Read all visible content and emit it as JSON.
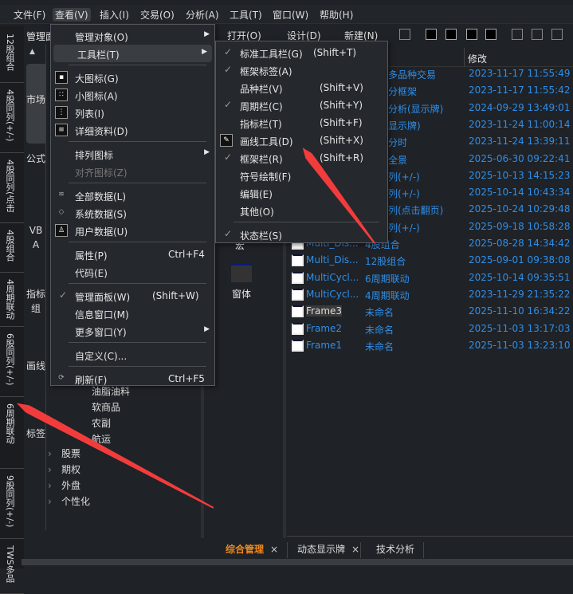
{
  "menubar": [
    "文件(F)",
    "查看(V)",
    "插入(I)",
    "交易(O)",
    "分析(A)",
    "工具(T)",
    "窗口(W)",
    "帮助(H)"
  ],
  "vertical_tabs": [
    "12股组合",
    "4股同列(+/-)",
    "4股同列(点击",
    "4股组合",
    "4周期联动",
    "6股同列(+/-)",
    "6周期联动",
    "9股同列(+/-)",
    "TWS多品"
  ],
  "panel_title": "管理面",
  "side_tabs": [
    "市场",
    "公式",
    "VBA",
    "指标组",
    "画线",
    "标签"
  ],
  "tree": {
    "items": [
      "油脂油料",
      "软商品",
      "农副",
      "航运"
    ],
    "groups": [
      "股票",
      "期权",
      "外盘",
      "个性化"
    ]
  },
  "toolbar": {
    "open": "打开(O)",
    "design": "设计(D)",
    "new": "新建(N)"
  },
  "icons_panel": {
    "macro": "宏",
    "form": "窗体"
  },
  "table": {
    "header_modified": "修改",
    "rows": [
      {
        "name": "",
        "desc": "多品种交易",
        "time": "2023-11-17 11:55:49"
      },
      {
        "name": "",
        "desc": "分框架",
        "time": "2023-11-17 11:55:42"
      },
      {
        "name": "",
        "desc": "分析(显示牌)",
        "time": "2024-09-29 13:49:01"
      },
      {
        "name": "",
        "desc": "显示牌)",
        "time": "2023-11-24 11:00:14"
      },
      {
        "name": "",
        "desc": "分时",
        "time": "2023-11-24 13:39:11"
      },
      {
        "name": "",
        "desc": "全景",
        "time": "2025-06-30 09:22:41"
      },
      {
        "name": "",
        "desc": "列(+/-)",
        "time": "2025-10-13 14:15:23"
      },
      {
        "name": "",
        "desc": "列(+/-)",
        "time": "2025-10-14 10:43:34"
      },
      {
        "name": "",
        "desc": "列(点击翻页)",
        "time": "2025-10-24 10:29:48"
      },
      {
        "name": "",
        "desc": "列(+/-)",
        "time": "2025-09-18 10:58:28"
      },
      {
        "name": "Multi_Dis...",
        "desc": "4股组合",
        "time": "2025-08-28 14:34:42"
      },
      {
        "name": "Multi_Dis...",
        "desc": "12股组合",
        "time": "2025-09-01 09:38:08"
      },
      {
        "name": "MultiCycl...",
        "desc": "6周期联动",
        "time": "2025-10-14 09:35:51"
      },
      {
        "name": "MultiCycl...",
        "desc": "4周期联动",
        "time": "2023-11-29 21:35:22"
      },
      {
        "name": "Frame3",
        "desc": "未命名",
        "time": "2025-11-10 16:34:22"
      },
      {
        "name": "Frame2",
        "desc": "未命名",
        "time": "2025-11-03 13:17:03"
      },
      {
        "name": "Frame1",
        "desc": "未命名",
        "time": "2025-11-03 13:23:10"
      }
    ]
  },
  "bottom_tabs": [
    "综合管理",
    "动态显示牌",
    "技术分析"
  ],
  "view_menu": [
    {
      "label": "管理对象(O)",
      "sub": true
    },
    {
      "label": "工具栏(T)",
      "sub": true,
      "hl": true
    },
    {
      "sep": true
    },
    {
      "label": "大图标(G)",
      "icon": "large-icons-icon"
    },
    {
      "label": "小图标(A)",
      "icon": "small-icons-icon"
    },
    {
      "label": "列表(I)",
      "icon": "list-icon"
    },
    {
      "label": "详细资料(D)",
      "icon": "details-icon"
    },
    {
      "sep": true
    },
    {
      "label": "排列图标",
      "sub": true
    },
    {
      "label": "对齐图标(Z)",
      "disabled": true
    },
    {
      "sep": true
    },
    {
      "label": "全部数据(L)",
      "icon": "layers-icon"
    },
    {
      "label": "系统数据(S)",
      "icon": "layer-icon"
    },
    {
      "label": "用户数据(U)",
      "icon": "user-icon"
    },
    {
      "sep": true
    },
    {
      "label": "属性(P)",
      "shortcut": "Ctrl+F4"
    },
    {
      "label": "代码(E)"
    },
    {
      "sep": true
    },
    {
      "label": "管理面板(W)",
      "shortcut": "(Shift+W)",
      "checked": true
    },
    {
      "label": "信息窗口(M)"
    },
    {
      "label": "更多窗口(Y)",
      "sub": true
    },
    {
      "sep": true
    },
    {
      "label": "自定义(C)..."
    },
    {
      "sep": true
    },
    {
      "label": "刷新(F)",
      "shortcut": "Ctrl+F5",
      "icon": "refresh-icon"
    }
  ],
  "toolbar_menu": [
    {
      "label": "标准工具栏(G)",
      "shortcut": "(Shift+T)",
      "checked": true
    },
    {
      "label": "框架标签(A)",
      "checked": true
    },
    {
      "label": "品种栏(V)",
      "shortcut": "(Shift+V)"
    },
    {
      "label": "周期栏(C)",
      "shortcut": "(Shift+Y)",
      "checked": true
    },
    {
      "label": "指标栏(T)",
      "shortcut": "(Shift+F)"
    },
    {
      "label": "画线工具(D)",
      "shortcut": "(Shift+X)",
      "icon": "drawing-tool-icon"
    },
    {
      "label": "框架栏(R)",
      "shortcut": "(Shift+R)",
      "checked": true
    },
    {
      "label": "符号绘制(F)"
    },
    {
      "label": "编辑(E)"
    },
    {
      "label": "其他(O)"
    },
    {
      "sep": true
    },
    {
      "label": "状态栏(S)",
      "checked": true
    }
  ],
  "colors": {
    "link": "#2f8fe8",
    "active_tab": "#f08a1c",
    "arrow": "#f23c3c"
  }
}
